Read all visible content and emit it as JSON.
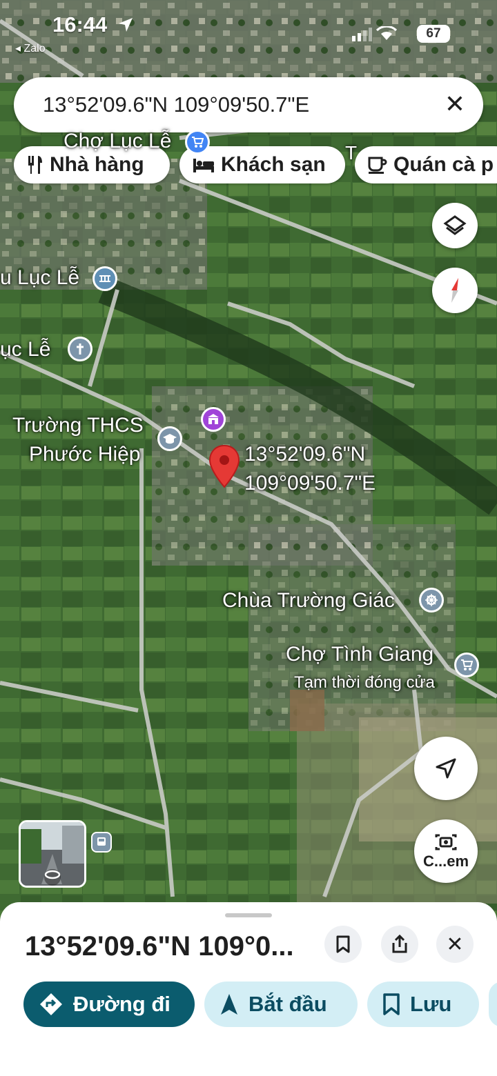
{
  "status_bar": {
    "time": "16:44",
    "back_app": "◂ Zalo",
    "battery": "67"
  },
  "search": {
    "query": "13°52'09.6\"N 109°09'50.7\"E"
  },
  "chips": [
    {
      "label": "Nhà hàng",
      "icon": "restaurant-icon"
    },
    {
      "label": "Khách sạn",
      "icon": "hotel-icon"
    },
    {
      "label": "Quán cà p",
      "icon": "coffee-icon"
    }
  ],
  "map_labels": {
    "market_top": "Chợ Lục Lễ",
    "label_2": "u Lục Lễ",
    "label_3": "ục Lễ",
    "school_line1": "Trường THCS",
    "school_line2": "Phước Hiệp",
    "pin_line1": "13°52'09.6\"N",
    "pin_line2": "109°09'50.7\"E",
    "temple": "Chùa Trường Giác",
    "market_bottom": "Chợ Tình Giang",
    "market_bottom_status": "Tạm thời đóng cửa",
    "cut_label": "T"
  },
  "map_buttons": {
    "camera_label": "C...em"
  },
  "sheet": {
    "title": "13°52'09.6\"N 109°0...",
    "actions": [
      {
        "label": "Đường đi",
        "icon": "directions-icon"
      },
      {
        "label": "Bắt đầu",
        "icon": "navigation-arrow-icon"
      },
      {
        "label": "Lưu",
        "icon": "bookmark-icon"
      }
    ]
  },
  "colors": {
    "primary_button": "#0b5c6e",
    "secondary_button": "#d3eef5",
    "pin": "#e53935",
    "accent_text": "#0b4c61"
  }
}
